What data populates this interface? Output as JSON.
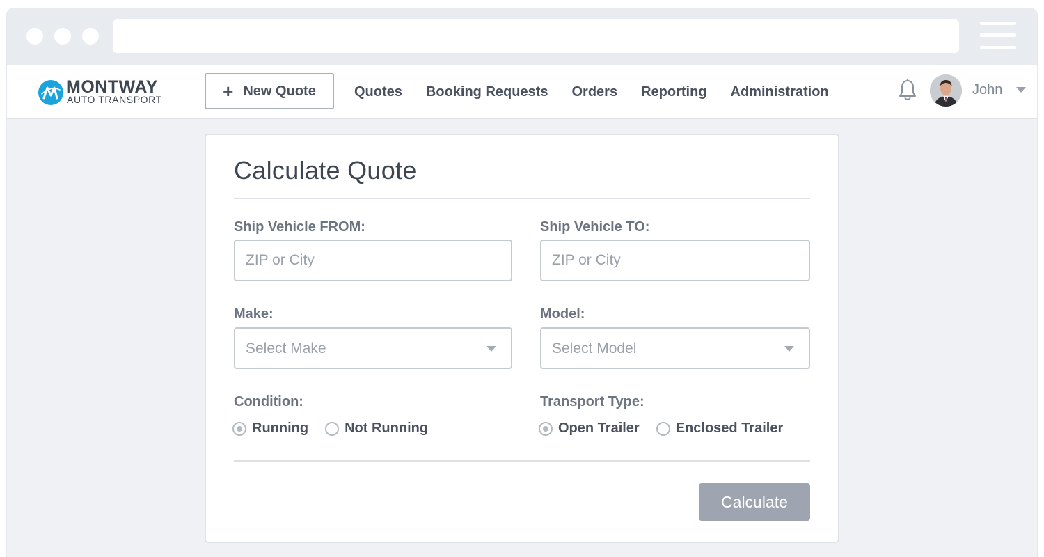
{
  "brand": {
    "name": "MONTWAY",
    "tagline": "AUTO TRANSPORT",
    "accent_color": "#1aa3dd"
  },
  "nav": {
    "new_quote_label": "New Quote",
    "links": [
      "Quotes",
      "Booking Requests",
      "Orders",
      "Reporting",
      "Administration"
    ],
    "notification_icon": "bell-icon",
    "user_name": "John"
  },
  "form": {
    "title": "Calculate Quote",
    "from": {
      "label": "Ship Vehicle FROM:",
      "placeholder": "ZIP or City",
      "value": ""
    },
    "to": {
      "label": "Ship Vehicle TO:",
      "placeholder": "ZIP or City",
      "value": ""
    },
    "make": {
      "label": "Make:",
      "selected": "Select Make"
    },
    "model": {
      "label": "Model:",
      "selected": "Select Model"
    },
    "condition": {
      "label": "Condition:",
      "options": [
        {
          "label": "Running",
          "checked": true
        },
        {
          "label": "Not Running",
          "checked": false
        }
      ]
    },
    "transport_type": {
      "label": "Transport Type:",
      "options": [
        {
          "label": "Open Trailer",
          "checked": true
        },
        {
          "label": "Enclosed Trailer",
          "checked": false
        }
      ]
    },
    "submit_label": "Calculate"
  }
}
